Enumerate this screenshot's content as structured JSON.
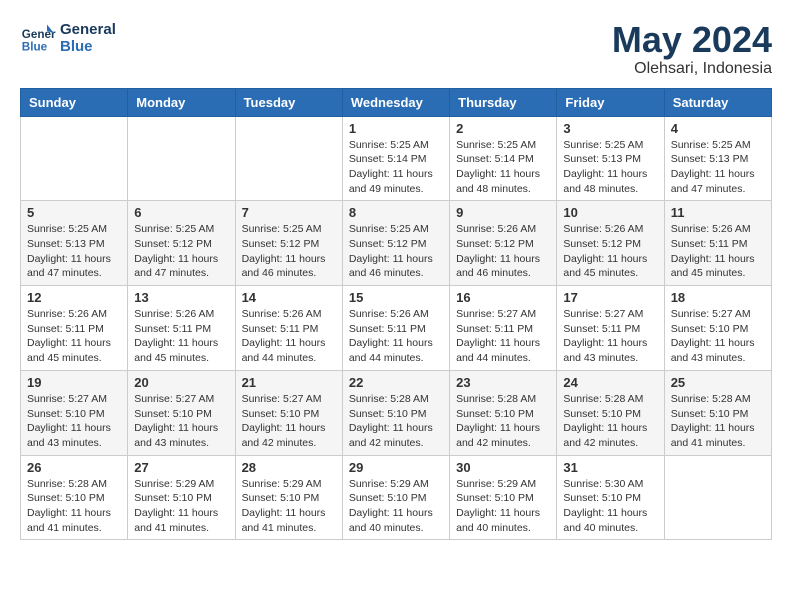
{
  "logo": {
    "line1": "General",
    "line2": "Blue"
  },
  "title": "May 2024",
  "location": "Olehsari, Indonesia",
  "weekdays": [
    "Sunday",
    "Monday",
    "Tuesday",
    "Wednesday",
    "Thursday",
    "Friday",
    "Saturday"
  ],
  "weeks": [
    [
      {
        "day": "",
        "info": ""
      },
      {
        "day": "",
        "info": ""
      },
      {
        "day": "",
        "info": ""
      },
      {
        "day": "1",
        "info": "Sunrise: 5:25 AM\nSunset: 5:14 PM\nDaylight: 11 hours\nand 49 minutes."
      },
      {
        "day": "2",
        "info": "Sunrise: 5:25 AM\nSunset: 5:14 PM\nDaylight: 11 hours\nand 48 minutes."
      },
      {
        "day": "3",
        "info": "Sunrise: 5:25 AM\nSunset: 5:13 PM\nDaylight: 11 hours\nand 48 minutes."
      },
      {
        "day": "4",
        "info": "Sunrise: 5:25 AM\nSunset: 5:13 PM\nDaylight: 11 hours\nand 47 minutes."
      }
    ],
    [
      {
        "day": "5",
        "info": "Sunrise: 5:25 AM\nSunset: 5:13 PM\nDaylight: 11 hours\nand 47 minutes."
      },
      {
        "day": "6",
        "info": "Sunrise: 5:25 AM\nSunset: 5:12 PM\nDaylight: 11 hours\nand 47 minutes."
      },
      {
        "day": "7",
        "info": "Sunrise: 5:25 AM\nSunset: 5:12 PM\nDaylight: 11 hours\nand 46 minutes."
      },
      {
        "day": "8",
        "info": "Sunrise: 5:25 AM\nSunset: 5:12 PM\nDaylight: 11 hours\nand 46 minutes."
      },
      {
        "day": "9",
        "info": "Sunrise: 5:26 AM\nSunset: 5:12 PM\nDaylight: 11 hours\nand 46 minutes."
      },
      {
        "day": "10",
        "info": "Sunrise: 5:26 AM\nSunset: 5:12 PM\nDaylight: 11 hours\nand 45 minutes."
      },
      {
        "day": "11",
        "info": "Sunrise: 5:26 AM\nSunset: 5:11 PM\nDaylight: 11 hours\nand 45 minutes."
      }
    ],
    [
      {
        "day": "12",
        "info": "Sunrise: 5:26 AM\nSunset: 5:11 PM\nDaylight: 11 hours\nand 45 minutes."
      },
      {
        "day": "13",
        "info": "Sunrise: 5:26 AM\nSunset: 5:11 PM\nDaylight: 11 hours\nand 45 minutes."
      },
      {
        "day": "14",
        "info": "Sunrise: 5:26 AM\nSunset: 5:11 PM\nDaylight: 11 hours\nand 44 minutes."
      },
      {
        "day": "15",
        "info": "Sunrise: 5:26 AM\nSunset: 5:11 PM\nDaylight: 11 hours\nand 44 minutes."
      },
      {
        "day": "16",
        "info": "Sunrise: 5:27 AM\nSunset: 5:11 PM\nDaylight: 11 hours\nand 44 minutes."
      },
      {
        "day": "17",
        "info": "Sunrise: 5:27 AM\nSunset: 5:11 PM\nDaylight: 11 hours\nand 43 minutes."
      },
      {
        "day": "18",
        "info": "Sunrise: 5:27 AM\nSunset: 5:10 PM\nDaylight: 11 hours\nand 43 minutes."
      }
    ],
    [
      {
        "day": "19",
        "info": "Sunrise: 5:27 AM\nSunset: 5:10 PM\nDaylight: 11 hours\nand 43 minutes."
      },
      {
        "day": "20",
        "info": "Sunrise: 5:27 AM\nSunset: 5:10 PM\nDaylight: 11 hours\nand 43 minutes."
      },
      {
        "day": "21",
        "info": "Sunrise: 5:27 AM\nSunset: 5:10 PM\nDaylight: 11 hours\nand 42 minutes."
      },
      {
        "day": "22",
        "info": "Sunrise: 5:28 AM\nSunset: 5:10 PM\nDaylight: 11 hours\nand 42 minutes."
      },
      {
        "day": "23",
        "info": "Sunrise: 5:28 AM\nSunset: 5:10 PM\nDaylight: 11 hours\nand 42 minutes."
      },
      {
        "day": "24",
        "info": "Sunrise: 5:28 AM\nSunset: 5:10 PM\nDaylight: 11 hours\nand 42 minutes."
      },
      {
        "day": "25",
        "info": "Sunrise: 5:28 AM\nSunset: 5:10 PM\nDaylight: 11 hours\nand 41 minutes."
      }
    ],
    [
      {
        "day": "26",
        "info": "Sunrise: 5:28 AM\nSunset: 5:10 PM\nDaylight: 11 hours\nand 41 minutes."
      },
      {
        "day": "27",
        "info": "Sunrise: 5:29 AM\nSunset: 5:10 PM\nDaylight: 11 hours\nand 41 minutes."
      },
      {
        "day": "28",
        "info": "Sunrise: 5:29 AM\nSunset: 5:10 PM\nDaylight: 11 hours\nand 41 minutes."
      },
      {
        "day": "29",
        "info": "Sunrise: 5:29 AM\nSunset: 5:10 PM\nDaylight: 11 hours\nand 40 minutes."
      },
      {
        "day": "30",
        "info": "Sunrise: 5:29 AM\nSunset: 5:10 PM\nDaylight: 11 hours\nand 40 minutes."
      },
      {
        "day": "31",
        "info": "Sunrise: 5:30 AM\nSunset: 5:10 PM\nDaylight: 11 hours\nand 40 minutes."
      },
      {
        "day": "",
        "info": ""
      }
    ]
  ]
}
